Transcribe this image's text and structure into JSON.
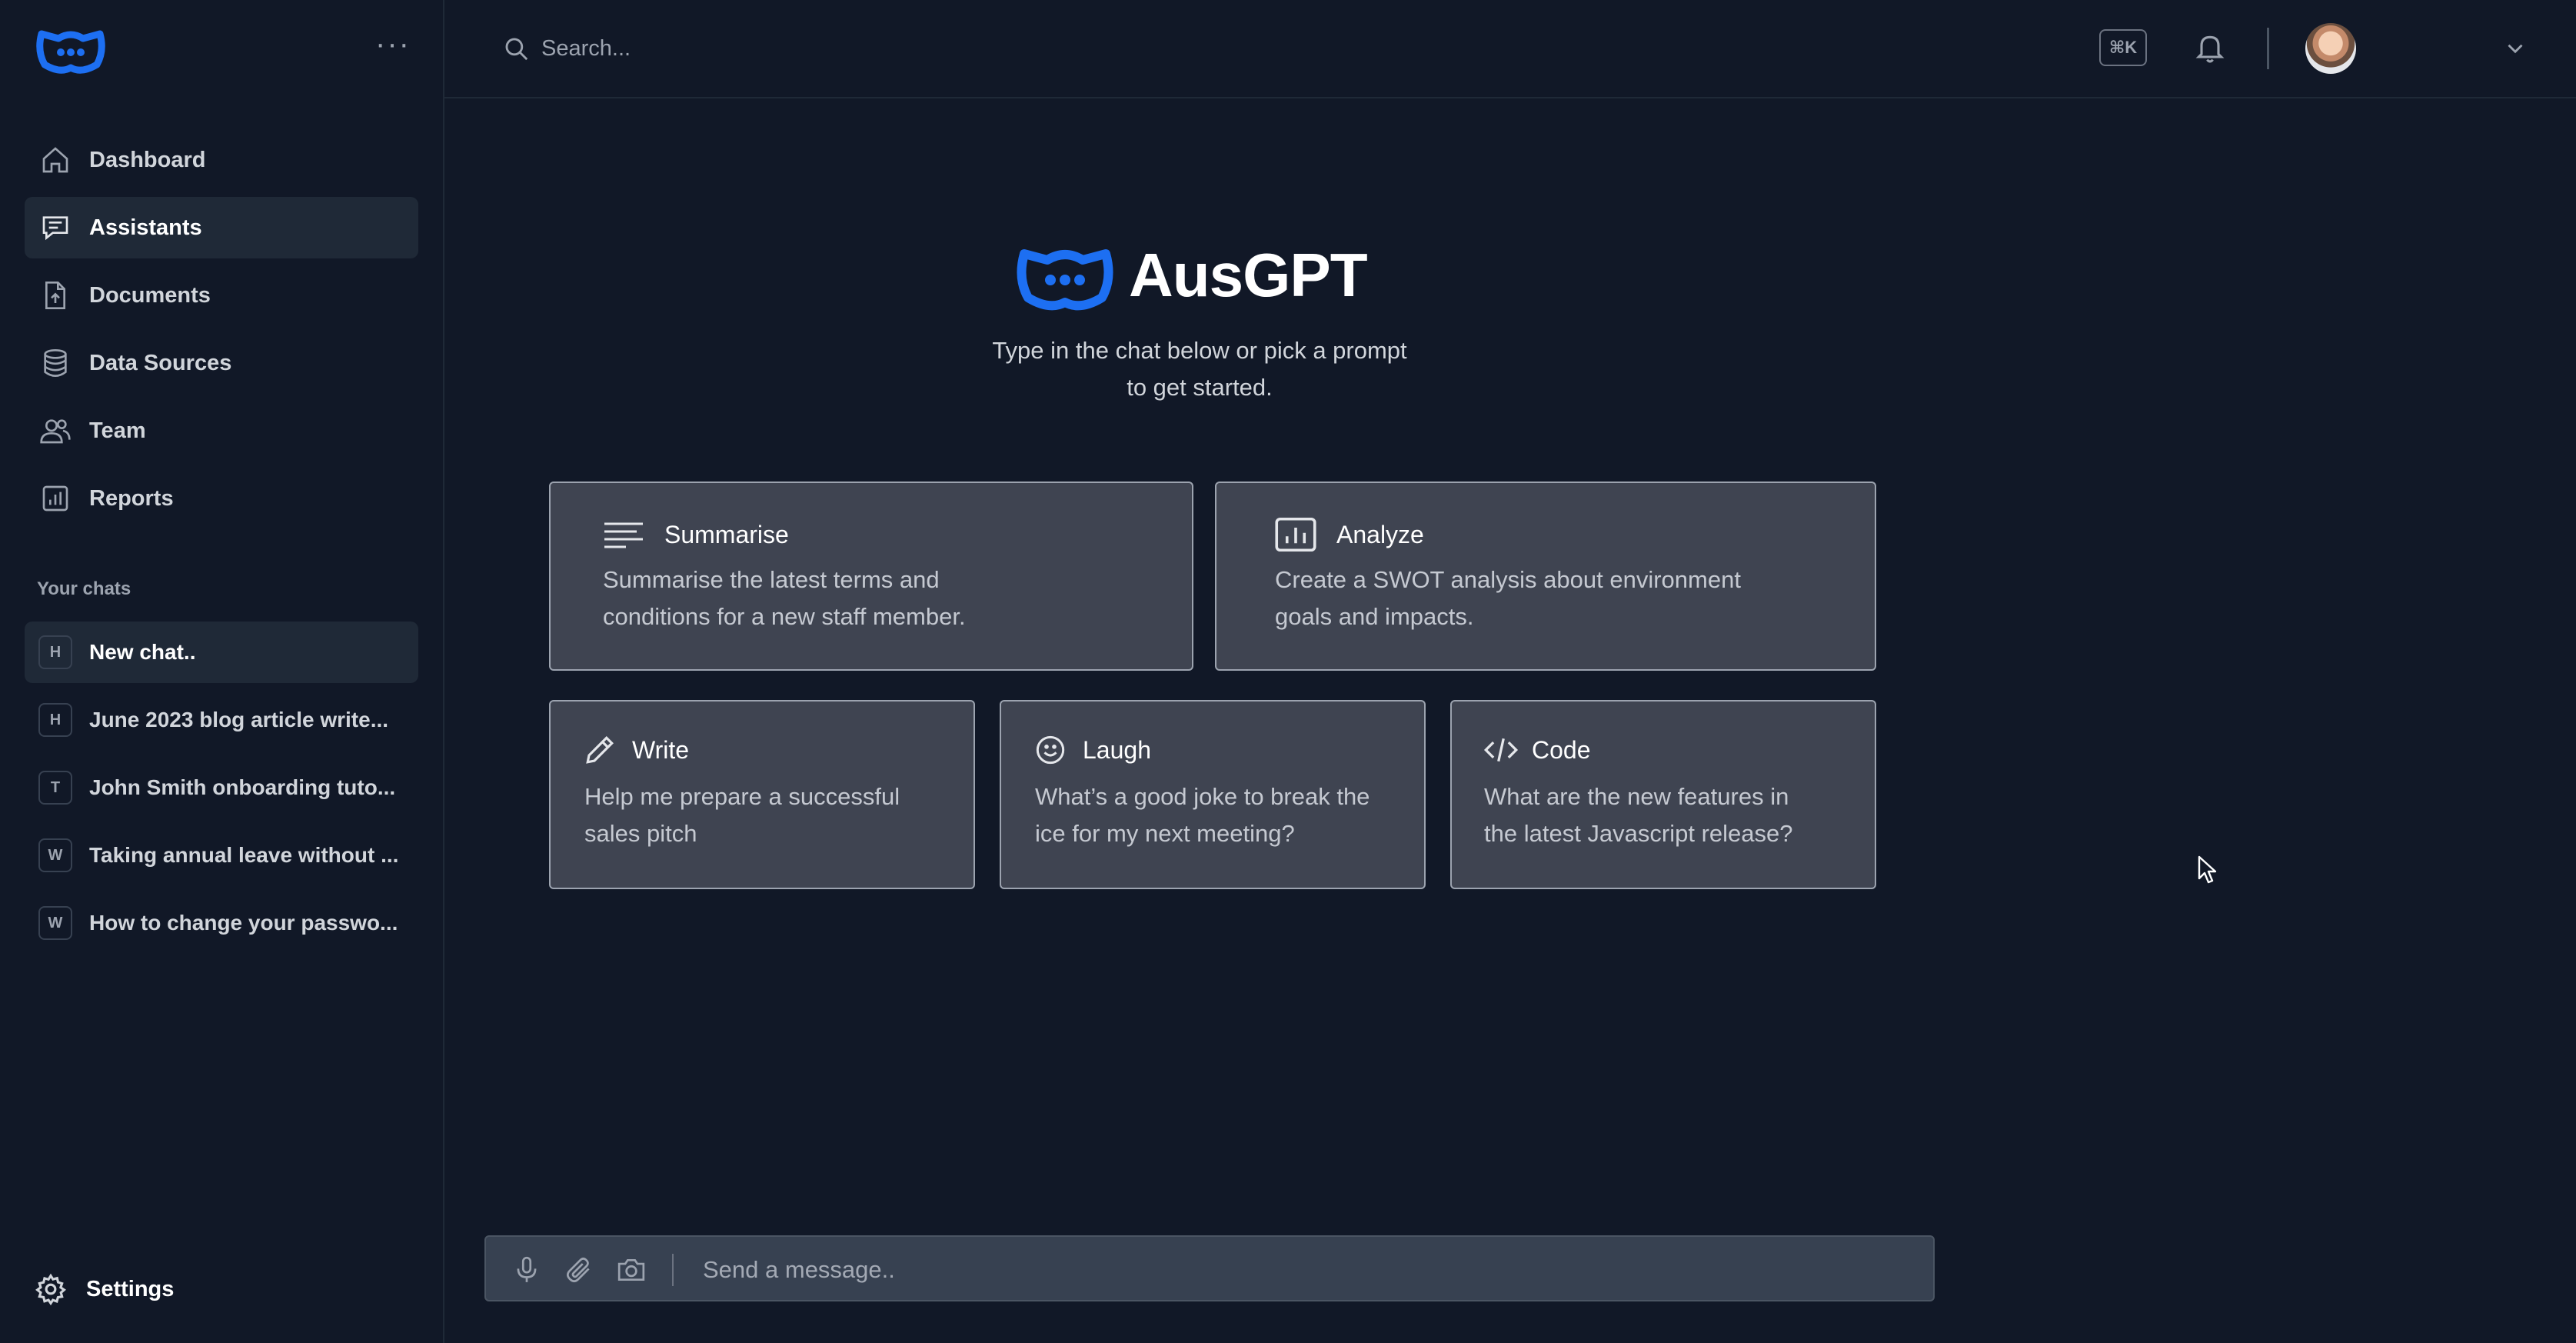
{
  "search": {
    "placeholder": "Search..."
  },
  "header": {
    "shortcut": "⌘K"
  },
  "nav": [
    {
      "label": "Dashboard",
      "icon": "home-icon"
    },
    {
      "label": "Assistants",
      "icon": "chat-icon",
      "active": true
    },
    {
      "label": "Documents",
      "icon": "document-upload-icon"
    },
    {
      "label": "Data Sources",
      "icon": "database-icon"
    },
    {
      "label": "Team",
      "icon": "users-icon"
    },
    {
      "label": "Reports",
      "icon": "bar-chart-icon"
    }
  ],
  "chats": {
    "heading": "Your chats",
    "items": [
      {
        "badge": "H",
        "label": "New chat..",
        "active": true
      },
      {
        "badge": "H",
        "label": "June 2023 blog article write..."
      },
      {
        "badge": "T",
        "label": "John Smith onboarding tuto..."
      },
      {
        "badge": "W",
        "label": "Taking annual leave without ..."
      },
      {
        "badge": "W",
        "label": "How to change your passwo..."
      }
    ]
  },
  "settings": {
    "label": "Settings"
  },
  "hero": {
    "title": "AusGPT",
    "subtitle_line1": "Type in the chat below or pick a prompt",
    "subtitle_line2": "to get started."
  },
  "prompts": {
    "summarise": {
      "title": "Summarise",
      "line1": "Summarise the latest terms and",
      "line2": "conditions for a new staff member."
    },
    "analyze": {
      "title": "Analyze",
      "line1": "Create a SWOT analysis about environment",
      "line2": "goals and impacts."
    },
    "write": {
      "title": "Write",
      "line1": "Help me prepare a successful",
      "line2": "sales pitch"
    },
    "laugh": {
      "title": "Laugh",
      "line1": "What’s a good joke to break the",
      "line2": "ice for my next meeting?"
    },
    "code": {
      "title": "Code",
      "line1": "What are the new features in",
      "line2": "the latest Javascript release?"
    }
  },
  "composer": {
    "placeholder": "Send a message.."
  },
  "colors": {
    "accent": "#1d6ff2",
    "background": "#111827",
    "card": "#3f4451"
  }
}
